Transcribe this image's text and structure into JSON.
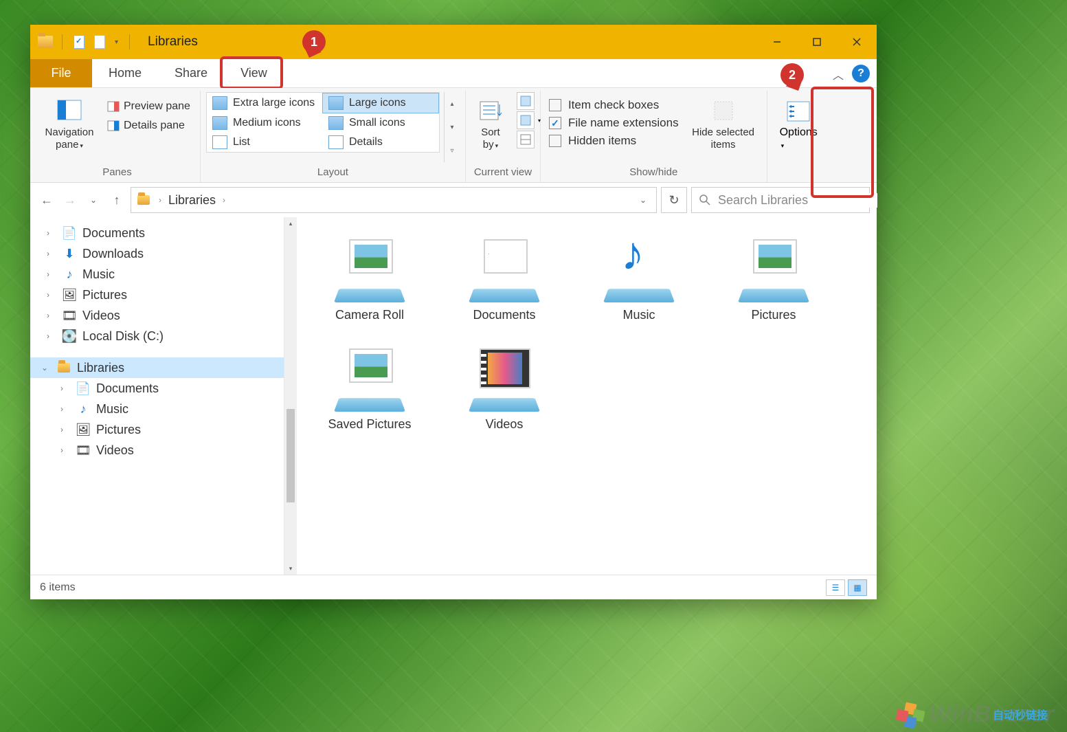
{
  "title": "Libraries",
  "tabs": {
    "file": "File",
    "home": "Home",
    "share": "Share",
    "view": "View"
  },
  "annotations": {
    "one": "1",
    "two": "2"
  },
  "ribbon": {
    "panes": {
      "label": "Panes",
      "navigation": "Navigation pane",
      "preview": "Preview pane",
      "details": "Details pane"
    },
    "layout": {
      "label": "Layout",
      "xl": "Extra large icons",
      "lg": "Large icons",
      "md": "Medium icons",
      "sm": "Small icons",
      "list": "List",
      "det": "Details"
    },
    "current": {
      "label": "Current view",
      "sortby": "Sort by"
    },
    "showhide": {
      "label": "Show/hide",
      "check": "Item check boxes",
      "ext": "File name extensions",
      "hidden": "Hidden items",
      "hide": "Hide selected items"
    },
    "options": "Options"
  },
  "address": {
    "seg1": "Libraries"
  },
  "search": {
    "placeholder": "Search Libraries"
  },
  "tree": {
    "docs": "Documents",
    "dl": "Downloads",
    "music": "Music",
    "pics": "Pictures",
    "vids": "Videos",
    "cdrive": "Local Disk (C:)",
    "libraries": "Libraries",
    "ldocs": "Documents",
    "lmusic": "Music",
    "lpics": "Pictures",
    "lvids": "Videos"
  },
  "items": {
    "cameraroll": "Camera Roll",
    "documents": "Documents",
    "music": "Music",
    "pictures": "Pictures",
    "savedpics": "Saved Pictures",
    "videos": "Videos"
  },
  "status": "6 items",
  "watermark": "WinBuzzer",
  "cn": "自动秒链接"
}
